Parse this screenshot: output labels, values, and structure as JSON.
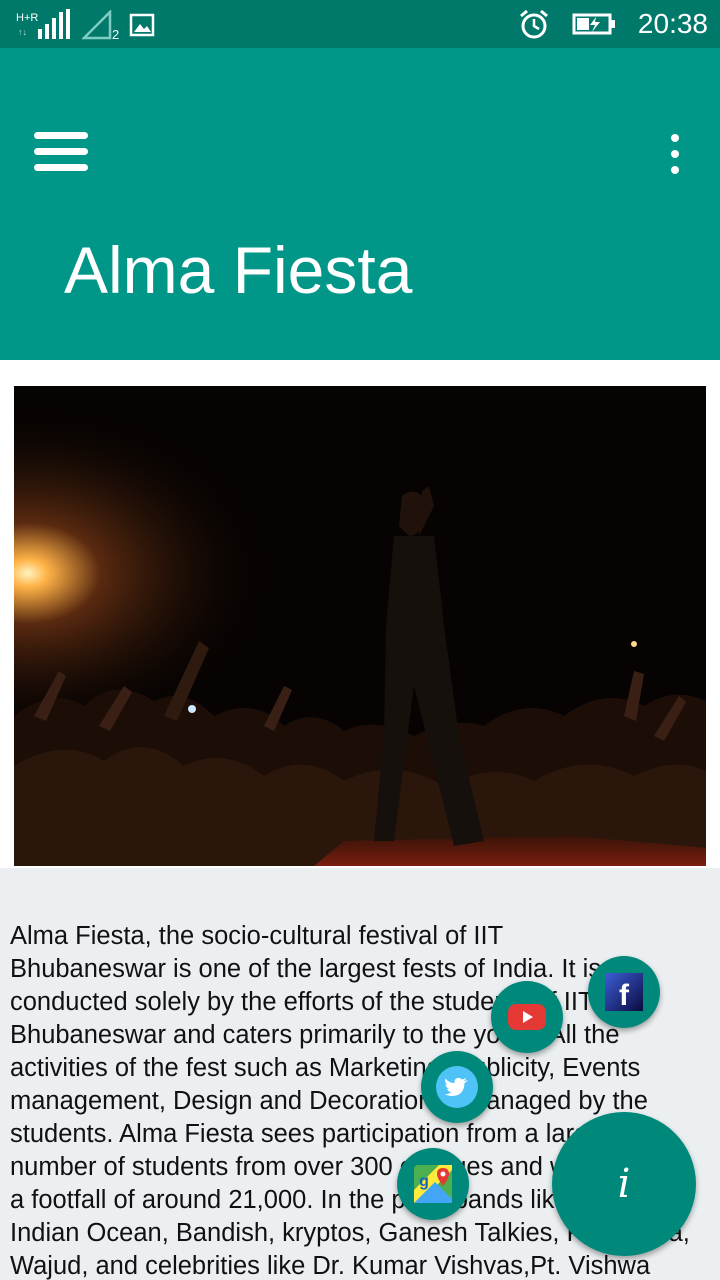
{
  "status_bar": {
    "network_label": "H+R",
    "sim_slot": "2",
    "time": "20:38",
    "icons": [
      "signal-icon",
      "no-signal-icon",
      "gallery-icon",
      "alarm-icon",
      "battery-charging-icon"
    ]
  },
  "app_bar": {
    "title": "Alma Fiesta",
    "menu_icon": "hamburger-menu-icon",
    "overflow_icon": "more-vert-icon",
    "color": "#009688",
    "status_color": "#00796b"
  },
  "hero_image": {
    "description_icon": "concert-photo"
  },
  "article": {
    "lines": [
      " Alma Fiesta, the socio-cultural festival of IIT",
      "Bhubaneswar is one of the largest fests of India. It is",
      "conducted solely by the efforts of the students of IIT",
      "Bhubaneswar and caters primarily to the youth. All the",
      "activities of the fest such as Marketing, Publicity, Events",
      "management, Design and Decoration is managed by the",
      "students. Alma Fiesta sees participation from a large",
      "number of students from over 300 colleges and with",
      "a footfall of around 21,000. In the past, bands like Euphoria,",
      "Indian Ocean, Bandish, kryptos, Ganesh Talkies, Parikrama,",
      "Wajud, and celebrities like Dr. Kumar Vishvas,Pt. Vishwa"
    ]
  },
  "fabs": {
    "facebook": "facebook-icon",
    "youtube": "youtube-icon",
    "twitter": "twitter-icon",
    "maps": "google-maps-icon",
    "info": "info-icon",
    "info_glyph": "i",
    "color": "#00897b"
  }
}
